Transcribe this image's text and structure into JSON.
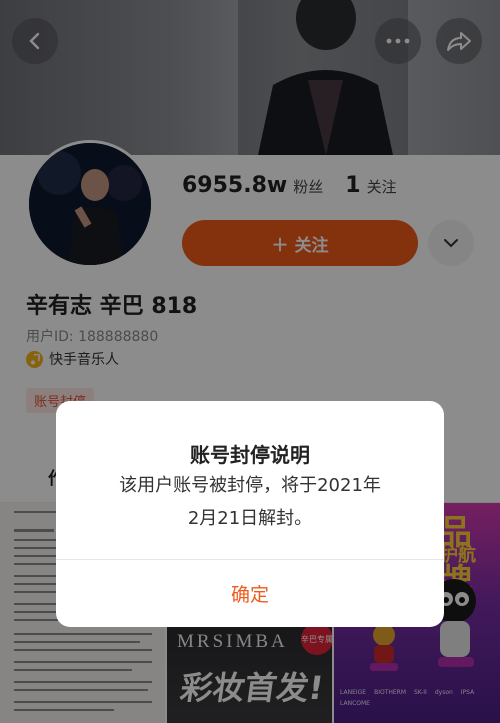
{
  "profile": {
    "followers_count": "6955.8w",
    "followers_label": "粉丝",
    "following_count": "1",
    "following_label": "关注",
    "follow_button_label": "＋ 关注",
    "name": "辛有志 辛巴 818",
    "user_id": "用户ID: 188888880",
    "certification": "快手音乐人",
    "ban_tag": "账号封停"
  },
  "tabs": {
    "first_label": "作"
  },
  "thumbnails": {
    "makeup_brand": "MRSIMBA",
    "makeup_launch": "彩妆首发!",
    "makeup_badge": "辛巴专属",
    "right_banner_top": "品牌",
    "right_banner_sub": "护航",
    "brand_row": [
      "LANEIGE",
      "BIOTHERM",
      "SK-II",
      "dyson",
      "IPSA",
      "LANCOME"
    ]
  },
  "dialog": {
    "title": "账号封停说明",
    "message_line1": "该用户账号被封停，将于2021年",
    "message_line2": "2月21日解封。",
    "confirm_label": "确定"
  },
  "colors": {
    "accent": "#f05a1a",
    "ban_tag_text": "#e5533b",
    "certification_badge": "#f5b71a"
  },
  "icons": [
    "back-arrow-icon",
    "more-dots-icon",
    "share-icon",
    "chevron-down-icon",
    "music-note-icon"
  ]
}
